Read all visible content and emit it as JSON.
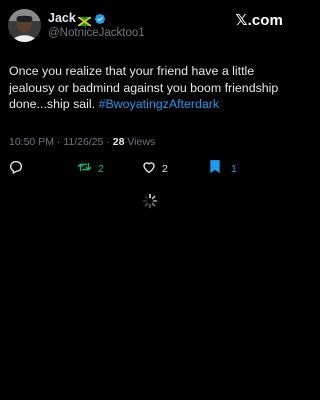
{
  "brand": {
    "label": "𝕏.com"
  },
  "user": {
    "display_name": "Jack",
    "handle": "@NotniceJacktoo1",
    "flag_icon": "jamaica-flag-icon",
    "verified_icon": "verified-badge-icon"
  },
  "tweet": {
    "text": "Once you realize that your friend have a little jealousy or badmind against you boom friendship done...ship sail.",
    "hashtag": "#BwoyatingzAfterdark"
  },
  "meta": {
    "time": "10:50 PM",
    "separator": " · ",
    "date": "11/26/25",
    "views_count": "28",
    "views_label": " Views"
  },
  "actions": {
    "reply": {
      "icon": "reply-bubble-icon",
      "count": ""
    },
    "retweet": {
      "icon": "retweet-icon",
      "count": "2",
      "color": "#00ba7c"
    },
    "like": {
      "icon": "heart-icon",
      "count": "2"
    },
    "bookmark": {
      "icon": "bookmark-icon",
      "count": "1",
      "color": "#1d9bf0"
    }
  },
  "colors": {
    "background": "#000000",
    "text": "#e7e9ea",
    "muted": "#71767b",
    "link": "#1d9bf0",
    "verified": "#1d9bf0",
    "retweet_active": "#00ba7c",
    "bookmark_active": "#1d9bf0"
  }
}
